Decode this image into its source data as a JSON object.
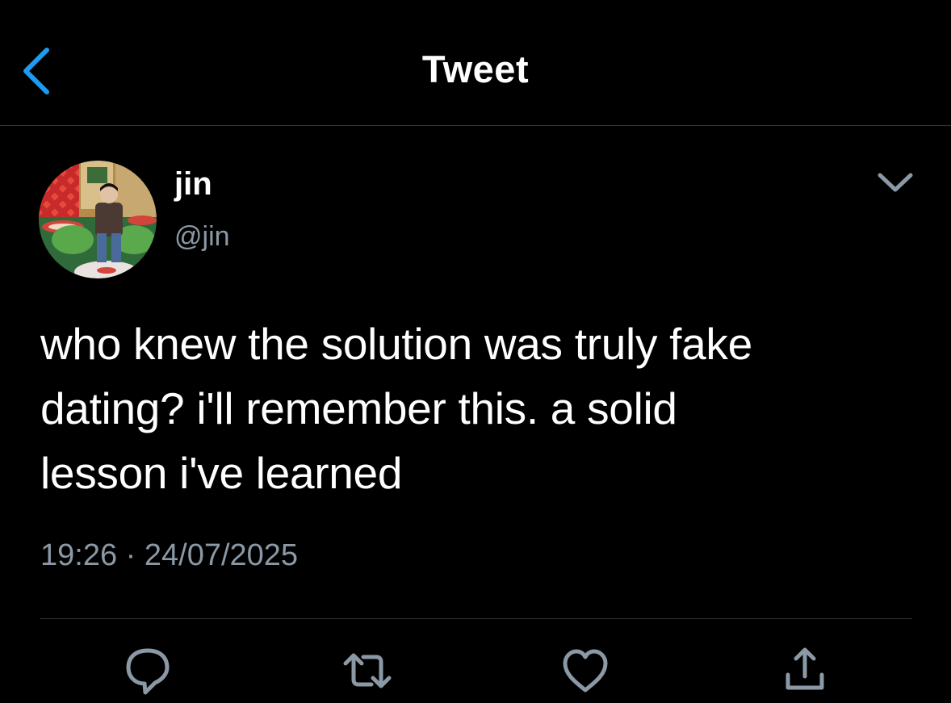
{
  "header": {
    "title": "Tweet",
    "back_icon": "chevron-left-icon",
    "accent_color": "#1d9bf0"
  },
  "tweet": {
    "author": {
      "display_name": "jin",
      "handle": "@jin",
      "avatar": "avatar-photo"
    },
    "text_lines": [
      "who knew the solution was truly fake",
      "dating? i'll remember this. a solid",
      "lesson i've learned"
    ],
    "time": "19:26",
    "separator": "·",
    "date": "24/07/2025",
    "more_icon": "chevron-down-icon"
  },
  "actions": [
    {
      "name": "reply",
      "icon": "reply-icon"
    },
    {
      "name": "retweet",
      "icon": "retweet-icon"
    },
    {
      "name": "like",
      "icon": "heart-icon"
    },
    {
      "name": "share",
      "icon": "share-icon"
    }
  ],
  "colors": {
    "background": "#000000",
    "text": "#ffffff",
    "secondary_text": "#8b98a5",
    "divider": "#2f3336"
  }
}
